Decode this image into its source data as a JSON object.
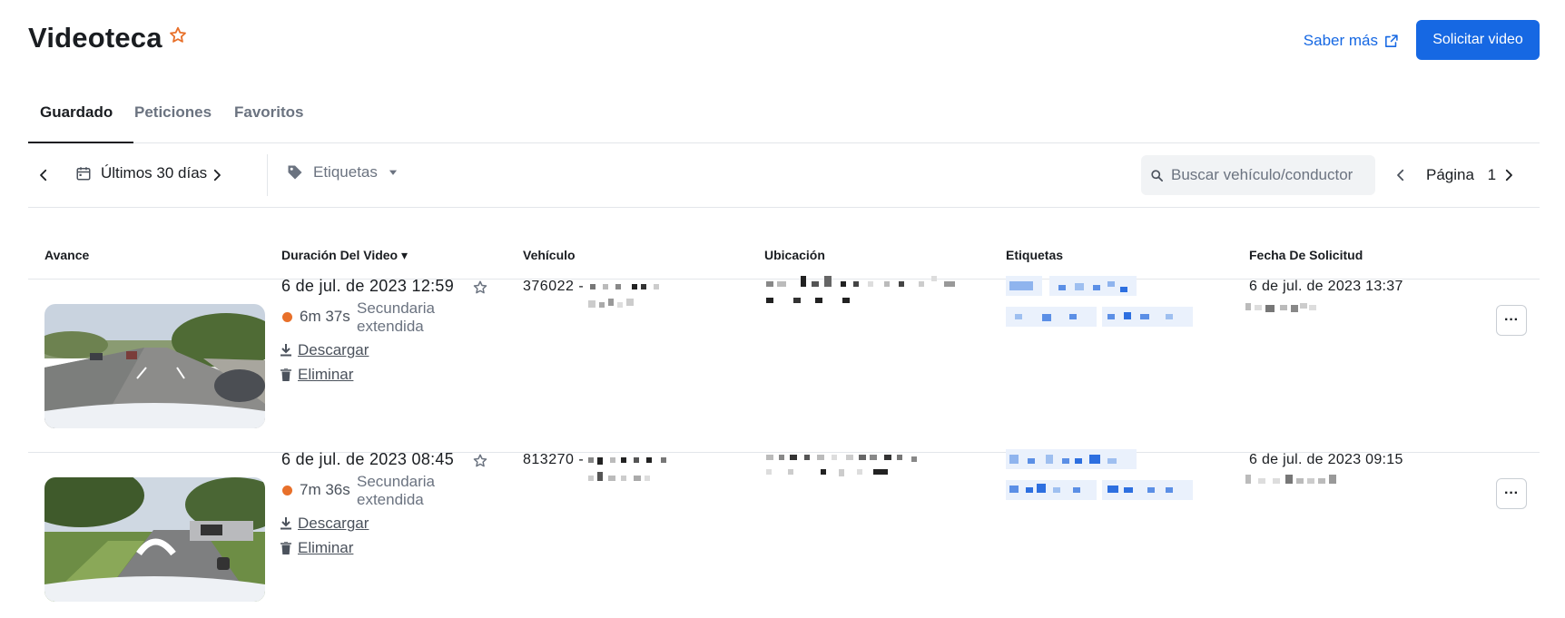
{
  "header": {
    "title": "Videoteca",
    "learn_more": "Saber más",
    "request_button": "Solicitar video",
    "accent_color": "#1668e3",
    "star_color": "#e8702a"
  },
  "tabs": [
    {
      "label": "Guardado",
      "active": true
    },
    {
      "label": "Peticiones",
      "active": false
    },
    {
      "label": "Favoritos",
      "active": false
    }
  ],
  "toolbar": {
    "date_range": "Últimos 30 días",
    "tags_label": "Etiquetas",
    "search_placeholder": "Buscar vehículo/conductor",
    "page_label": "Página",
    "page_number": "1"
  },
  "table": {
    "columns": [
      "Avance",
      "Duración Del Video ▾",
      "Vehículo",
      "Ubicación",
      "Etiquetas",
      "Fecha De Solicitud"
    ],
    "rows": [
      {
        "title": "6 de jul. de 2023 12:59",
        "duration": "6m 37s",
        "duration_type": "Secundaria extendida",
        "download": "Descargar",
        "delete": "Eliminar",
        "vehicle_id": "376022 -",
        "request_date": "6 de jul. de 2023 13:37",
        "more": "···"
      },
      {
        "title": "6 de jul. de 2023 08:45",
        "duration": "7m 36s",
        "duration_type": "Secundaria extendida",
        "download": "Descargar",
        "delete": "Eliminar",
        "vehicle_id": "813270 -",
        "request_date": "6 de jul. de 2023 09:15",
        "more": "···"
      }
    ]
  },
  "icons": {
    "title_star": "star-outline-icon",
    "external_link": "external-link-icon",
    "calendar": "calendar-icon",
    "tag": "tag-icon",
    "search": "search-icon",
    "download": "download-icon",
    "trash": "trash-icon"
  }
}
